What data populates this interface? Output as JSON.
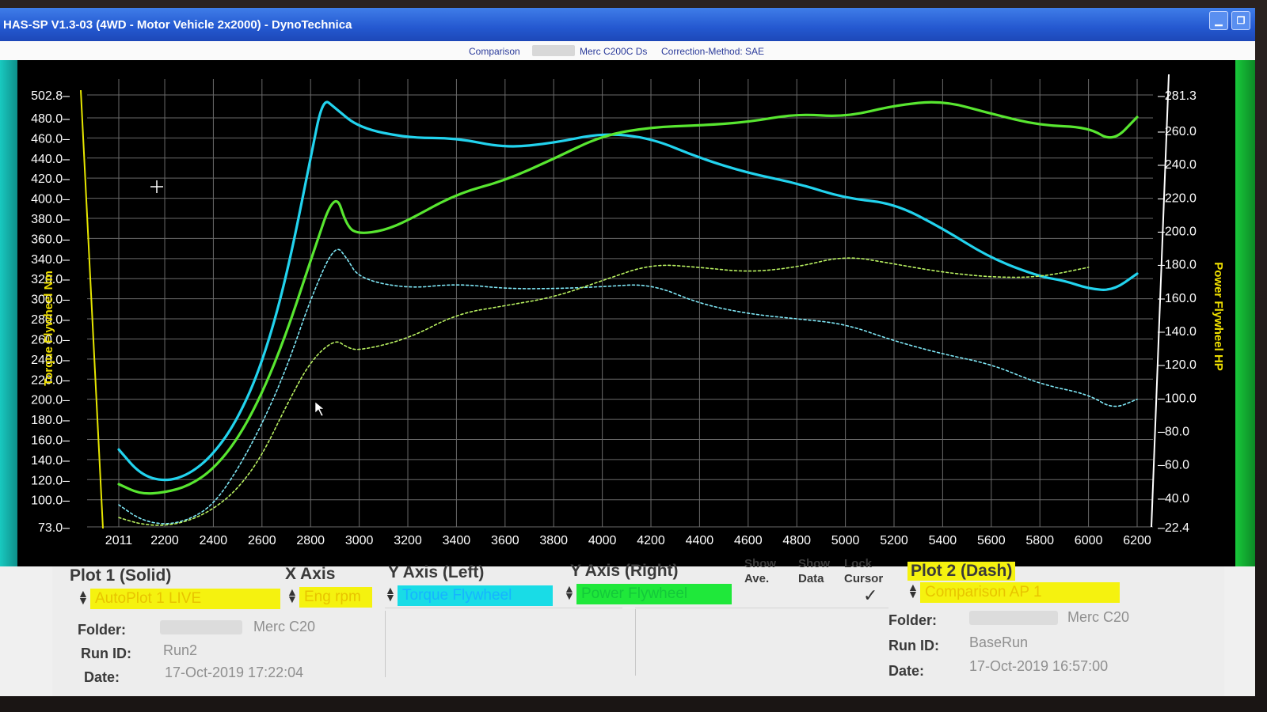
{
  "window": {
    "title": "HAS-SP V1.3-03  (4WD - Motor Vehicle 2x2000) - DynoTechnica"
  },
  "infobar": {
    "comparison_label": "Comparison",
    "comparison_name": "Merc C200C Ds",
    "correction": "Correction-Method: SAE"
  },
  "chart_data": {
    "type": "line",
    "xlabel": "",
    "ylabel_left": "Torque Flywheel Nm",
    "ylabel_right": "Power Flywheel HP",
    "xlim": [
      2011,
      6200
    ],
    "ylim_left": [
      73.0,
      502.8
    ],
    "ylim_right": [
      22.4,
      281.3
    ],
    "x_ticks": [
      "2011",
      "2200",
      "2400",
      "2600",
      "2800",
      "3000",
      "3200",
      "3400",
      "3600",
      "3800",
      "4000",
      "4200",
      "4400",
      "4600",
      "4800",
      "5000",
      "5200",
      "5400",
      "5600",
      "5800",
      "6000",
      "6200"
    ],
    "y_left_ticks": [
      "502.8",
      "480.0",
      "460.0",
      "440.0",
      "420.0",
      "400.0",
      "380.0",
      "360.0",
      "340.0",
      "320.0",
      "300.0",
      "280.0",
      "260.0",
      "240.0",
      "220.0",
      "200.0",
      "180.0",
      "160.0",
      "140.0",
      "120.0",
      "100.0",
      "73.0"
    ],
    "y_right_ticks": [
      "281.3",
      "260.0",
      "240.0",
      "220.0",
      "200.0",
      "180.0",
      "160.0",
      "140.0",
      "120.0",
      "100.0",
      "80.0",
      "60.0",
      "40.0",
      "22.4"
    ],
    "grid": true,
    "series": [
      {
        "name": "Torque Flywheel",
        "axis": "left",
        "style": "solid",
        "color": "#22d3ee",
        "x": [
          2011,
          2100,
          2200,
          2300,
          2400,
          2500,
          2600,
          2700,
          2800,
          2850,
          2900,
          3000,
          3200,
          3400,
          3600,
          3800,
          4000,
          4200,
          4400,
          4600,
          4800,
          5000,
          5200,
          5400,
          5600,
          5800,
          5900,
          6000,
          6100,
          6200
        ],
        "y": [
          150,
          125,
          118,
          125,
          145,
          180,
          235,
          320,
          440,
          500,
          490,
          470,
          460,
          460,
          450,
          455,
          465,
          460,
          440,
          425,
          415,
          400,
          395,
          370,
          340,
          322,
          318,
          310,
          308,
          325
        ]
      },
      {
        "name": "Power Flywheel",
        "axis": "right",
        "style": "solid",
        "color": "#58e630",
        "x": [
          2011,
          2100,
          2200,
          2300,
          2400,
          2500,
          2600,
          2700,
          2800,
          2900,
          2950,
          3000,
          3100,
          3200,
          3400,
          3600,
          3800,
          4000,
          4200,
          4400,
          4600,
          4800,
          5000,
          5200,
          5400,
          5600,
          5800,
          6000,
          6100,
          6200
        ],
        "y": [
          48,
          42,
          43,
          47,
          57,
          75,
          102,
          138,
          182,
          225,
          202,
          198,
          200,
          206,
          222,
          230,
          243,
          257,
          262,
          263,
          265,
          270,
          268,
          275,
          278,
          270,
          263,
          262,
          253,
          268
        ]
      },
      {
        "name": "Torque Flywheel (Comparison)",
        "axis": "left",
        "style": "dash",
        "color": "#7ee6f5",
        "x": [
          2011,
          2100,
          2200,
          2300,
          2400,
          2500,
          2600,
          2700,
          2800,
          2900,
          2950,
          3000,
          3200,
          3400,
          3600,
          3800,
          4000,
          4200,
          4400,
          4600,
          4800,
          5000,
          5200,
          5400,
          5600,
          5800,
          6000,
          6100,
          6200
        ],
        "y": [
          95,
          80,
          75,
          80,
          95,
          130,
          175,
          230,
          300,
          355,
          340,
          320,
          310,
          315,
          310,
          310,
          312,
          315,
          295,
          285,
          280,
          275,
          258,
          245,
          235,
          215,
          205,
          190,
          200
        ]
      },
      {
        "name": "Power Flywheel (Comparison)",
        "axis": "right",
        "style": "dash",
        "color": "#b8f060",
        "x": [
          2011,
          2100,
          2200,
          2300,
          2400,
          2500,
          2600,
          2700,
          2800,
          2900,
          2950,
          3000,
          3200,
          3400,
          3600,
          3800,
          4000,
          4200,
          4400,
          4600,
          4800,
          5000,
          5200,
          5400,
          5600,
          5800,
          6000
        ],
        "y": [
          28,
          24,
          23,
          26,
          33,
          45,
          65,
          95,
          122,
          135,
          130,
          128,
          135,
          150,
          155,
          160,
          170,
          180,
          178,
          175,
          178,
          185,
          180,
          175,
          172,
          172,
          178
        ]
      }
    ]
  },
  "panel": {
    "plot1_label": "Plot 1 (Solid)",
    "x_axis_label": "X Axis",
    "y_left_label": "Y Axis (Left)",
    "y_right_label": "Y Axis (Right)",
    "show_ave_label1": "Show",
    "show_ave_label2": "Ave.",
    "show_data_label1": "Show",
    "show_data_label2": "Data",
    "lock_cursor_label1": "Lock",
    "lock_cursor_label2": "Cursor",
    "plot2_label": "Plot 2 (Dash)",
    "plot1_select": "AutoPlot 1 LIVE",
    "x_axis_select": "Eng rpm",
    "y_left_select": "Torque Flywheel",
    "y_right_select": "Power Flywheel",
    "plot2_select": "Comparison AP 1",
    "folder_label": "Folder:",
    "runid_label": "Run ID:",
    "date_label": "Date:",
    "plot1_folder": "Merc C20",
    "plot1_runid": "Run2",
    "plot1_date": "17-Oct-2019  17:22:04",
    "plot2_folder": "Merc C20",
    "plot2_runid": "BaseRun",
    "plot2_date": "17-Oct-2019  16:57:00",
    "lock_check": "✓"
  },
  "colors": {
    "plot_bg": "#000000",
    "grid": "#6a6a6a",
    "left_axis": "#e6e600",
    "right_axis": "#ffffff",
    "tick_text": "#ffffff",
    "left_label": "#f0e000",
    "right_label": "#f0e000"
  }
}
